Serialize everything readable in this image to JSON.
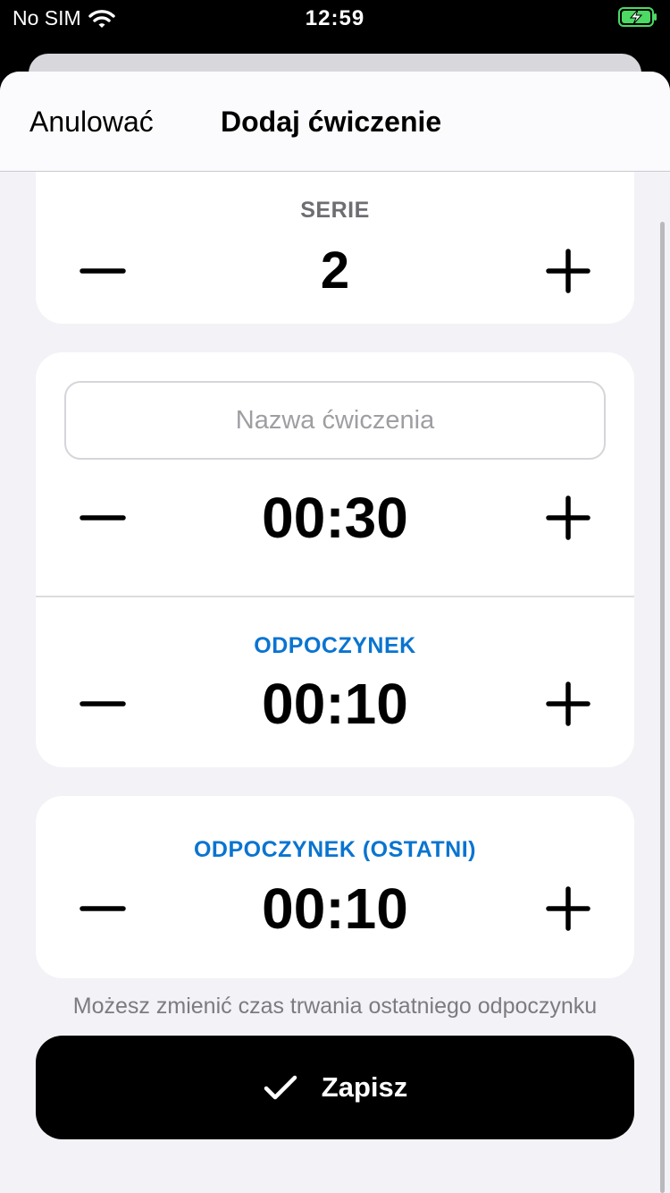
{
  "status_bar": {
    "carrier": "No SIM",
    "time": "12:59"
  },
  "header": {
    "cancel_label": "Anulować",
    "title": "Dodaj ćwiczenie"
  },
  "sets": {
    "label": "SERIE",
    "value": "2"
  },
  "exercise": {
    "name_placeholder": "Nazwa ćwiczenia",
    "name_value": "",
    "duration": "00:30"
  },
  "rest": {
    "label": "ODPOCZYNEK",
    "duration": "00:10"
  },
  "last_rest": {
    "label": "ODPOCZYNEK (OSTATNI)",
    "duration": "00:10"
  },
  "hint": "Możesz zmienić czas trwania ostatniego odpoczynku",
  "save": {
    "label": "Zapisz"
  },
  "icons": {
    "minus": "minus-icon",
    "plus": "plus-icon",
    "check": "checkmark-icon",
    "wifi": "wifi-icon",
    "battery": "battery-charging-icon"
  },
  "colors": {
    "accent_blue": "#0a74d0",
    "sheet_bg": "#f2f2f7",
    "card_bg": "#ffffff",
    "battery_green": "#4cd964"
  }
}
